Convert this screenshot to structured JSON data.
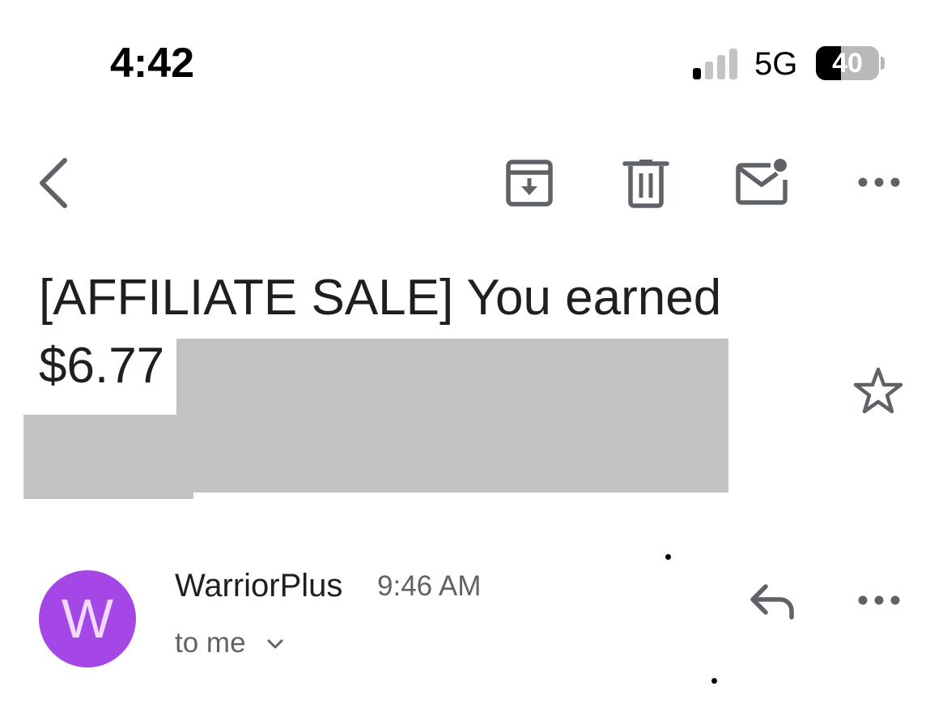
{
  "status_bar": {
    "time": "4:42",
    "network": "5G",
    "battery_level": "40",
    "battery_fraction": 0.4,
    "signal_bars_active": 1,
    "signal_bars_total": 4
  },
  "toolbar": {
    "back_icon": "chevron-left-icon",
    "archive_icon": "archive-icon",
    "delete_icon": "trash-icon",
    "mark_unread_icon": "mail-unread-icon",
    "more_icon": "more-horizontal-icon"
  },
  "email": {
    "subject_line_1": "[AFFILIATE SALE] You earned",
    "subject_amount": "$6.77",
    "starred": false
  },
  "sender": {
    "avatar_letter": "W",
    "avatar_color": "#a546e6",
    "name": "WarriorPlus",
    "time": "9:46 AM",
    "recipient": "to me",
    "reply_icon": "reply-icon",
    "more_icon": "more-horizontal-icon"
  },
  "colors": {
    "icon_gray": "#5f6368",
    "redaction_gray": "#c2c2c2"
  }
}
